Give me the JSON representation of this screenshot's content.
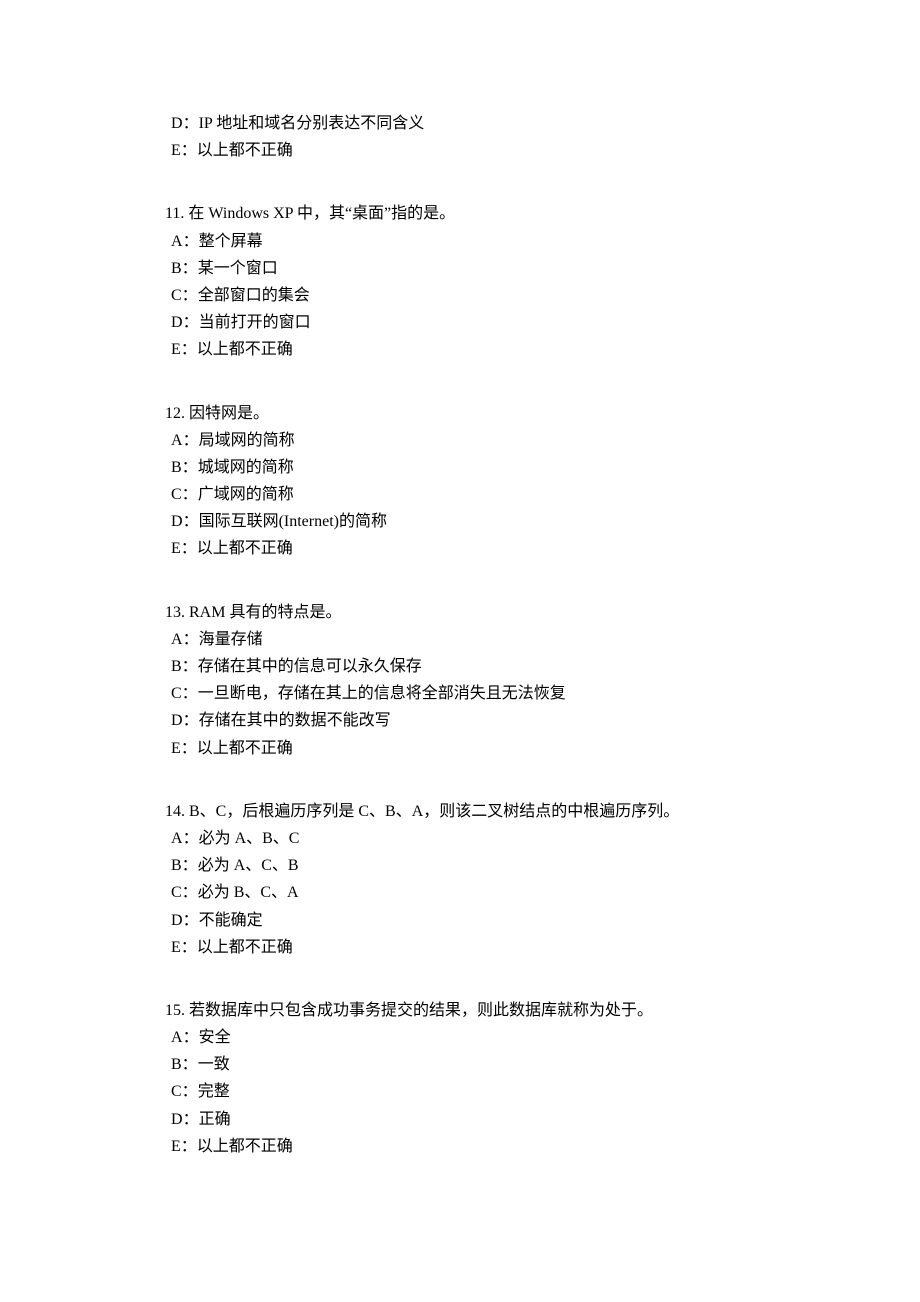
{
  "leading_options": [
    {
      "label": "D",
      "text": "IP 地址和域名分别表达不同含义"
    },
    {
      "label": "E",
      "text": "以上都不正确"
    }
  ],
  "questions": [
    {
      "number": "11.",
      "stem": " 在 Windows XP 中，其“桌面”指的是。",
      "options": [
        {
          "label": "A",
          "text": "整个屏幕"
        },
        {
          "label": "B",
          "text": "某一个窗口"
        },
        {
          "label": "C",
          "text": "全部窗口的集会"
        },
        {
          "label": "D",
          "text": "当前打开的窗口"
        },
        {
          "label": "E",
          "text": "以上都不正确"
        }
      ]
    },
    {
      "number": "12.",
      "stem": " 因特网是。",
      "options": [
        {
          "label": "A",
          "text": "局域网的简称"
        },
        {
          "label": "B",
          "text": "城域网的简称"
        },
        {
          "label": "C",
          "text": "广域网的简称"
        },
        {
          "label": "D",
          "text": "国际互联网(Internet)的简称"
        },
        {
          "label": "E",
          "text": "以上都不正确"
        }
      ]
    },
    {
      "number": "13.",
      "stem": " RAM 具有的特点是。",
      "options": [
        {
          "label": "A",
          "text": "海量存储"
        },
        {
          "label": "B",
          "text": "存储在其中的信息可以永久保存"
        },
        {
          "label": "C",
          "text": "一旦断电，存储在其上的信息将全部消失且无法恢复"
        },
        {
          "label": "D",
          "text": "存储在其中的数据不能改写"
        },
        {
          "label": "E",
          "text": "以上都不正确"
        }
      ]
    },
    {
      "number": "14.",
      "stem": " B、C，后根遍历序列是 C、B、A，则该二叉树结点的中根遍历序列。",
      "options": [
        {
          "label": "A",
          "text": "必为 A、B、C"
        },
        {
          "label": "B",
          "text": "必为 A、C、B"
        },
        {
          "label": "C",
          "text": "必为 B、C、A"
        },
        {
          "label": "D",
          "text": "不能确定"
        },
        {
          "label": "E",
          "text": "以上都不正确"
        }
      ]
    },
    {
      "number": "15.",
      "stem": " 若数据库中只包含成功事务提交的结果，则此数据库就称为处于。",
      "options": [
        {
          "label": "A",
          "text": "安全"
        },
        {
          "label": "B",
          "text": "一致"
        },
        {
          "label": "C",
          "text": "完整"
        },
        {
          "label": "D",
          "text": "正确"
        },
        {
          "label": "E",
          "text": "以上都不正确"
        }
      ]
    }
  ]
}
